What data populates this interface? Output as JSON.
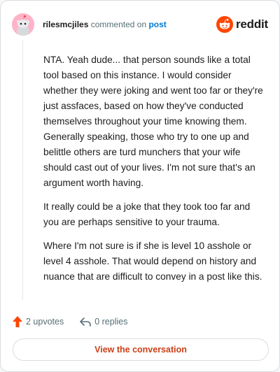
{
  "header": {
    "username": "rilesmcjiles",
    "action_text": "commented on",
    "post_link": "post",
    "brand_name": "reddit",
    "avatar_icon": "snoo-avatar-icon",
    "brand_icon": "reddit-logo-icon"
  },
  "comment": {
    "paragraphs": [
      "NTA. Yeah dude... that person sounds like a total tool based on this instance. I would consider whether they were joking and went too far or they're just assfaces, based on how they've conducted themselves throughout your time knowing them. Generally speaking, those who try to one up and belittle others are turd munchers that your wife should cast out of your lives. I'm not sure that's an argument worth having.",
      "It really could be a joke that they took too far and you are perhaps sensitive to your trauma.",
      "Where I'm not sure is if she is level 10 asshole or level 4 asshole. That would depend on history and nuance that are difficult to convey in a post like this."
    ]
  },
  "actions": {
    "upvotes": "2 upvotes",
    "replies": "0 replies",
    "upvote_icon": "upvote-arrow-icon",
    "reply_icon": "reply-arrow-icon"
  },
  "cta": {
    "label": "View the conversation"
  },
  "colors": {
    "brand": "#ff4500",
    "link": "#0079d3",
    "cta_text": "#cc3e16",
    "avatar_bg": "#ffb3c8"
  }
}
